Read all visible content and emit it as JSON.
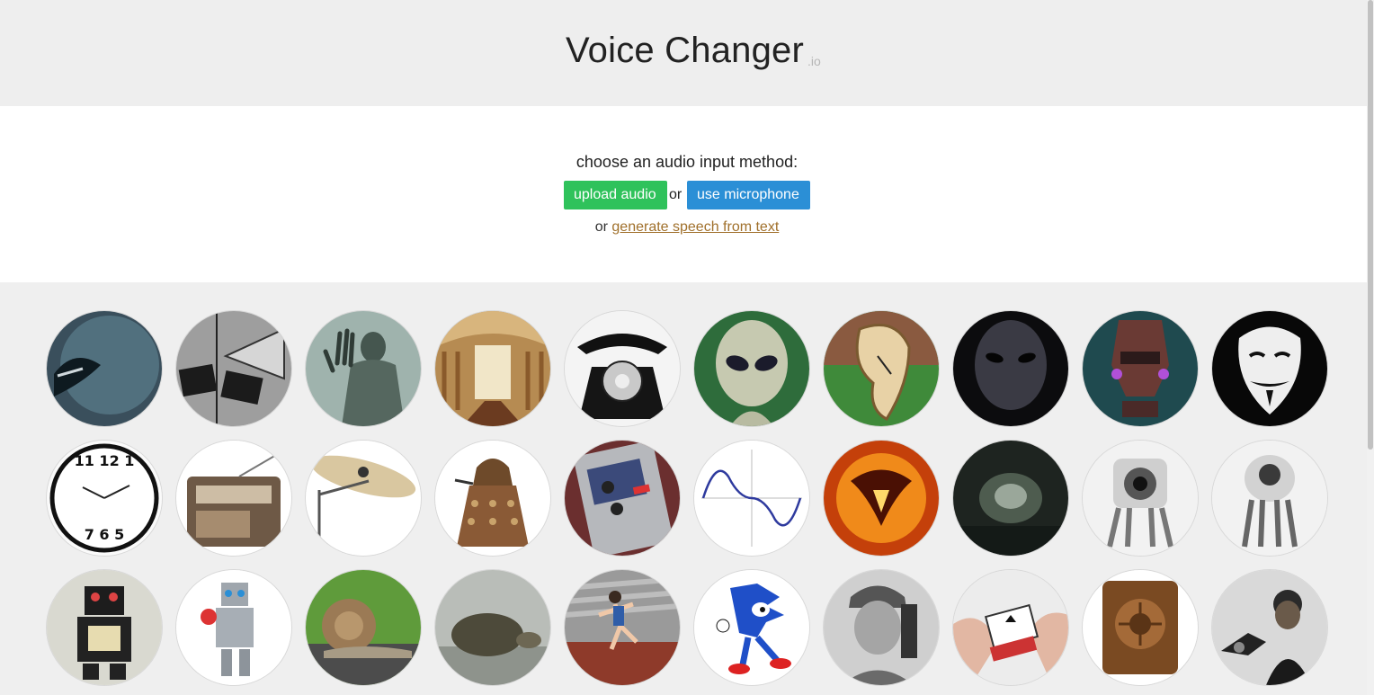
{
  "header": {
    "title": "Voice Changer",
    "title_suffix": ".io"
  },
  "input": {
    "prompt": "choose an audio input method:",
    "upload_label": "upload audio",
    "or_text": "or",
    "microphone_label": "use microphone",
    "alt_prefix": "or",
    "alt_link": "generate speech from text"
  },
  "colors": {
    "upload_button": "#2fc25b",
    "microphone_button": "#2b8fd6",
    "link": "#a0702b"
  },
  "voices": [
    {
      "icon": "monster-mouth-icon"
    },
    {
      "icon": "megaphone-speakers-icon"
    },
    {
      "icon": "ghost-figure-icon"
    },
    {
      "icon": "cathedral-icon"
    },
    {
      "icon": "rotary-phone-icon"
    },
    {
      "icon": "alien-icon"
    },
    {
      "icon": "melting-clock-icon"
    },
    {
      "icon": "dark-alien-icon"
    },
    {
      "icon": "robot-helmet-icon"
    },
    {
      "icon": "anonymous-mask-icon"
    },
    {
      "icon": "reversed-clock-icon"
    },
    {
      "icon": "vintage-radio-icon"
    },
    {
      "icon": "cymbal-icon"
    },
    {
      "icon": "dalek-icon"
    },
    {
      "icon": "effects-pedal-icon"
    },
    {
      "icon": "sine-wave-icon"
    },
    {
      "icon": "fire-demon-icon"
    },
    {
      "icon": "cave-icon"
    },
    {
      "icon": "robot-camera-icon"
    },
    {
      "icon": "robot-speaker-icon"
    },
    {
      "icon": "tin-robot-icon"
    },
    {
      "icon": "toy-robot-icon"
    },
    {
      "icon": "snail-icon"
    },
    {
      "icon": "tortoise-icon"
    },
    {
      "icon": "sprinter-icon"
    },
    {
      "icon": "sonic-hedgehog-icon"
    },
    {
      "icon": "soldier-radio-icon"
    },
    {
      "icon": "playing-cards-icon"
    },
    {
      "icon": "wooden-radio-speaker-icon"
    },
    {
      "icon": "gramophone-man-icon"
    }
  ]
}
